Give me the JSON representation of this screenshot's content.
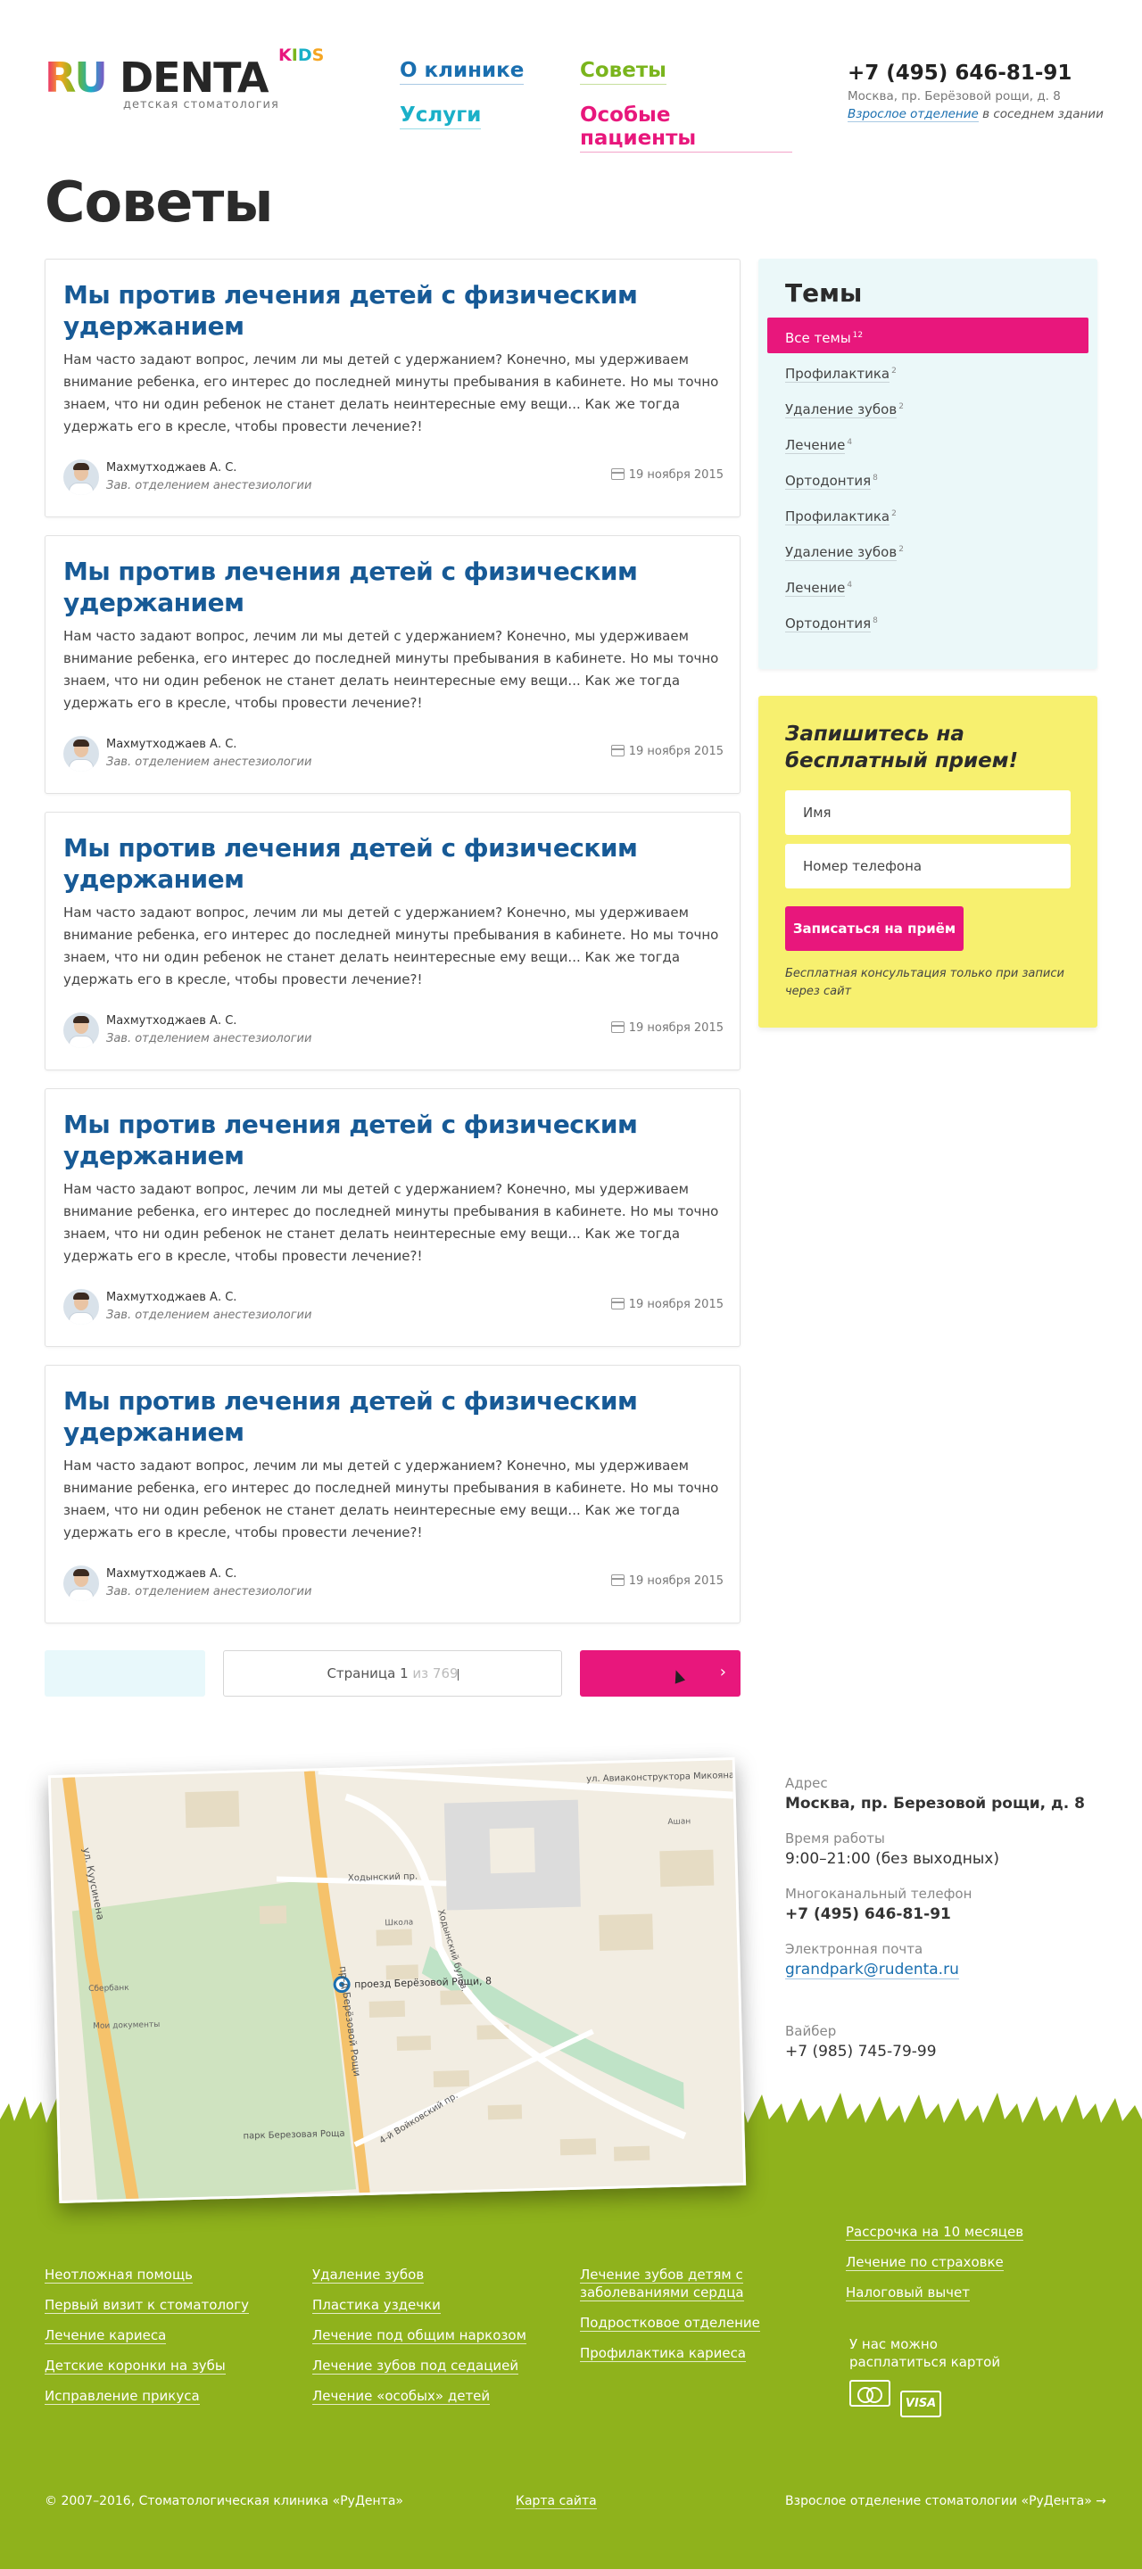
{
  "header": {
    "logo_ru": "RU",
    "logo_denta": "DENTA",
    "logo_kids": "KIDS",
    "logo_subtitle": "детская стоматология",
    "nav": [
      {
        "label": "О клинике",
        "color": "#1a6fb0"
      },
      {
        "label": "Советы",
        "color": "#7ab51d"
      },
      {
        "label": "Услуги",
        "color": "#1ab0c8"
      },
      {
        "label": "Особые пациенты",
        "color": "#e8177c"
      }
    ],
    "phone": "+7 (495) 646-81-91",
    "address": "Москва, пр. Берёзовой рощи, д. 8",
    "adult_link": "Взрослое отделение",
    "adult_suffix": "в соседнем здании"
  },
  "page_title": "Советы",
  "articles": [
    {
      "title": "Мы против лечения детей с физическим удержанием",
      "text": "Нам часто задают вопрос, лечим ли мы детей с удержанием? Конечно, мы удерживаем внимание ребенка, его интерес до последней минуты пребывания в кабинете. Но мы точно знаем, что ни один ребенок не станет делать неинтересные ему вещи... Как же тогда удержать его в кресле, чтобы провести лечение?!",
      "author": "Махмутходжаев А. С.",
      "role": "Зав. отделением анестезиологии",
      "date": "19 ноября 2015"
    },
    {
      "title": "Мы против лечения детей с физическим удержанием",
      "text": "Нам часто задают вопрос, лечим ли мы детей с удержанием? Конечно, мы удерживаем внимание ребенка, его интерес до последней минуты пребывания в кабинете. Но мы точно знаем, что ни один ребенок не станет делать неинтересные ему вещи... Как же тогда удержать его в кресле, чтобы провести лечение?!",
      "author": "Махмутходжаев А. С.",
      "role": "Зав. отделением анестезиологии",
      "date": "19 ноября 2015"
    },
    {
      "title": "Мы против лечения детей с физическим удержанием",
      "text": "Нам часто задают вопрос, лечим ли мы детей с удержанием? Конечно, мы удерживаем внимание ребенка, его интерес до последней минуты пребывания в кабинете. Но мы точно знаем, что ни один ребенок не станет делать неинтересные ему вещи... Как же тогда удержать его в кресле, чтобы провести лечение?!",
      "author": "Махмутходжаев А. С.",
      "role": "Зав. отделением анестезиологии",
      "date": "19 ноября 2015"
    },
    {
      "title": "Мы против лечения детей с физическим удержанием",
      "text": "Нам часто задают вопрос, лечим ли мы детей с удержанием? Конечно, мы удерживаем внимание ребенка, его интерес до последней минуты пребывания в кабинете. Но мы точно знаем, что ни один ребенок не станет делать неинтересные ему вещи... Как же тогда удержать его в кресле, чтобы провести лечение?!",
      "author": "Махмутходжаев А. С.",
      "role": "Зав. отделением анестезиологии",
      "date": "19 ноября 2015"
    },
    {
      "title": "Мы против лечения детей с физическим удержанием",
      "text": "Нам часто задают вопрос, лечим ли мы детей с удержанием? Конечно, мы удерживаем внимание ребенка, его интерес до последней минуты пребывания в кабинете. Но мы точно знаем, что ни один ребенок не станет делать неинтересные ему вещи... Как же тогда удержать его в кресле, чтобы провести лечение?!",
      "author": "Махмутходжаев А. С.",
      "role": "Зав. отделением анестезиологии",
      "date": "19 ноября 2015"
    }
  ],
  "pagination": {
    "page_label": "Страница 1",
    "of_label": "из 769",
    "next_icon": "chevron-right-icon"
  },
  "topics": {
    "title": "Темы",
    "items": [
      {
        "label": "Все темы",
        "count": "12",
        "active": true
      },
      {
        "label": "Профилактика",
        "count": "2"
      },
      {
        "label": "Удаление зубов",
        "count": "2"
      },
      {
        "label": "Лечение",
        "count": "4"
      },
      {
        "label": "Ортодонтия",
        "count": "8"
      },
      {
        "label": "Профилактика",
        "count": "2"
      },
      {
        "label": "Удаление зубов",
        "count": "2"
      },
      {
        "label": "Лечение",
        "count": "4"
      },
      {
        "label": "Ортодонтия",
        "count": "8"
      }
    ]
  },
  "signup": {
    "title": "Запишитесь на бесплатный прием!",
    "name_placeholder": "Имя",
    "phone_placeholder": "Номер телефона",
    "button": "Записаться на приём",
    "note": "Бесплатная консультация только при записи через сайт"
  },
  "map": {
    "streets": [
      "ул. Куусинена",
      "пр-д Берёзовой Рощи",
      "Ходынский пр.",
      "Ходынский бульв.",
      "4-й Войковский пр.",
      "ул. Авиаконструктора Микояна"
    ],
    "marker_label": "проезд Берёзовой Рощи, 8",
    "park_label": "парк Березовая Роща",
    "pois": [
      "Школа",
      "Сбербанк",
      "Мои документы",
      "Ашан"
    ]
  },
  "contact_info": {
    "address_label": "Адрес",
    "address": "Москва, пр. Березовой рощи, д. 8",
    "hours_label": "Время работы",
    "hours": "9:00–21:00 (без выходных)",
    "phone_label": "Многоканальный телефон",
    "phone": "+7 (495) 646-81-91",
    "email_label": "Электронная почта",
    "email": "grandpark@rudenta.ru",
    "viber_label": "Вайбер",
    "viber": "+7 (985) 745-79-99"
  },
  "footer": {
    "col1": [
      "Неотложная помощь",
      "Первый визит к стоматологу",
      "Лечение кариеса",
      "Детские коронки на зубы",
      "Исправление прикуса"
    ],
    "col2": [
      "Удаление зубов",
      "Пластика уздечки",
      "Лечение под общим наркозом",
      "Лечение зубов под седацией",
      "Лечение «особых» детей"
    ],
    "col3": [
      "Лечение зубов детям с заболеваниями сердца",
      "Подростковое отделение",
      "Профилактика кариеса"
    ],
    "col4": [
      "Рассрочка на 10 месяцев",
      "Лечение по страховке",
      "Налоговый вычет"
    ],
    "card_text": "У нас можно расплатиться картой",
    "card_visa": "VISA",
    "copyright": "© 2007–2016, Стоматологическая клиника «РуДента»",
    "sitemap": "Карта сайта",
    "adult_link": "Взрослое отделение стоматологии «РуДента» →"
  }
}
